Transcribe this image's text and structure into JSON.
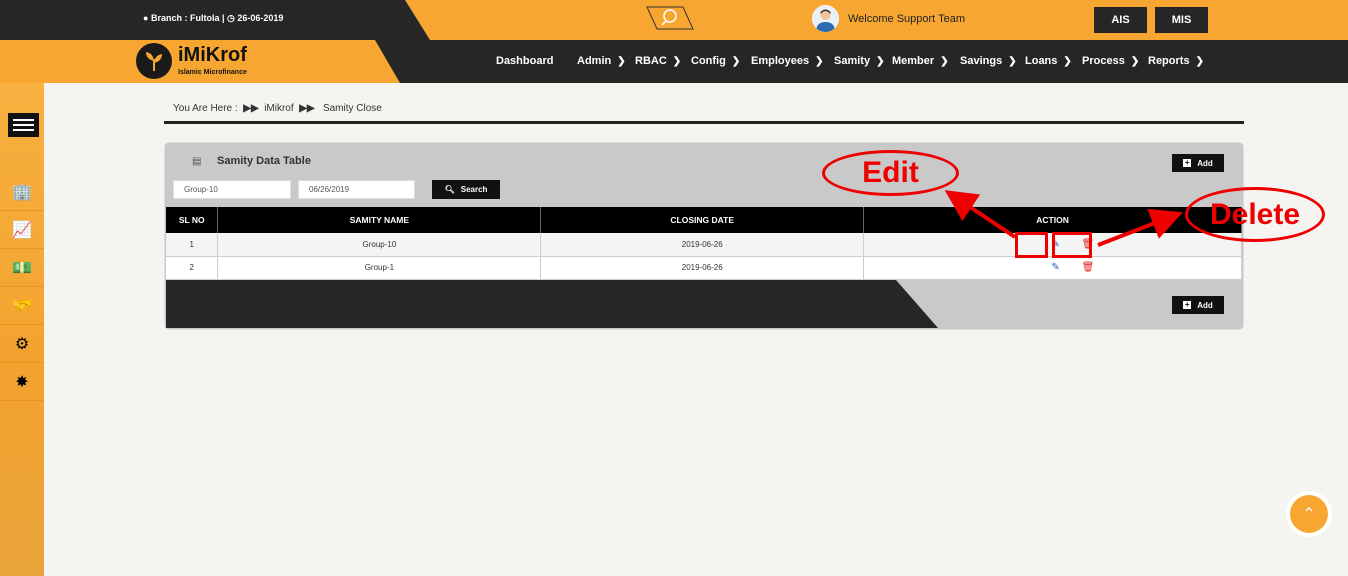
{
  "topbar": {
    "branch_label": "Branch : Fultola |",
    "date": "26-06-2019",
    "welcome": "Welcome Support Team",
    "ais_label": "AIS",
    "mis_label": "MIS"
  },
  "brand": {
    "title": "iMiKrof",
    "subtitle": "Islamic Microfinance"
  },
  "nav": {
    "items": [
      {
        "label": "Dashboard",
        "has_chevron": false
      },
      {
        "label": "Admin",
        "has_chevron": true
      },
      {
        "label": "RBAC",
        "has_chevron": true
      },
      {
        "label": "Config",
        "has_chevron": true
      },
      {
        "label": "Employees",
        "has_chevron": true
      },
      {
        "label": "Samity",
        "has_chevron": true
      },
      {
        "label": "Member",
        "has_chevron": true
      },
      {
        "label": "Savings",
        "has_chevron": true
      },
      {
        "label": "Loans",
        "has_chevron": true
      },
      {
        "label": "Process",
        "has_chevron": true
      },
      {
        "label": "Reports",
        "has_chevron": true
      }
    ]
  },
  "breadcrumb": {
    "prefix": "You Are Here  :",
    "level1": "iMikrof",
    "level2": "Samity Close"
  },
  "panel": {
    "title": "Samity Data Table",
    "add_label": "Add",
    "filter_samity_value": "Group-10",
    "filter_date_value": "06/26/2019",
    "search_label": "Search"
  },
  "table": {
    "headers": [
      "SL NO",
      "SAMITY NAME",
      "CLOSING DATE",
      "ACTION"
    ],
    "rows": [
      {
        "sl": "1",
        "name": "Group-10",
        "date": "2019-06-26"
      },
      {
        "sl": "2",
        "name": "Group-1",
        "date": "2019-06-26"
      }
    ]
  },
  "annotations": {
    "edit_label": "Edit",
    "delete_label": "Delete",
    "color": "#e00000"
  },
  "colors": {
    "accent": "#f7a731",
    "dark": "#262626"
  }
}
